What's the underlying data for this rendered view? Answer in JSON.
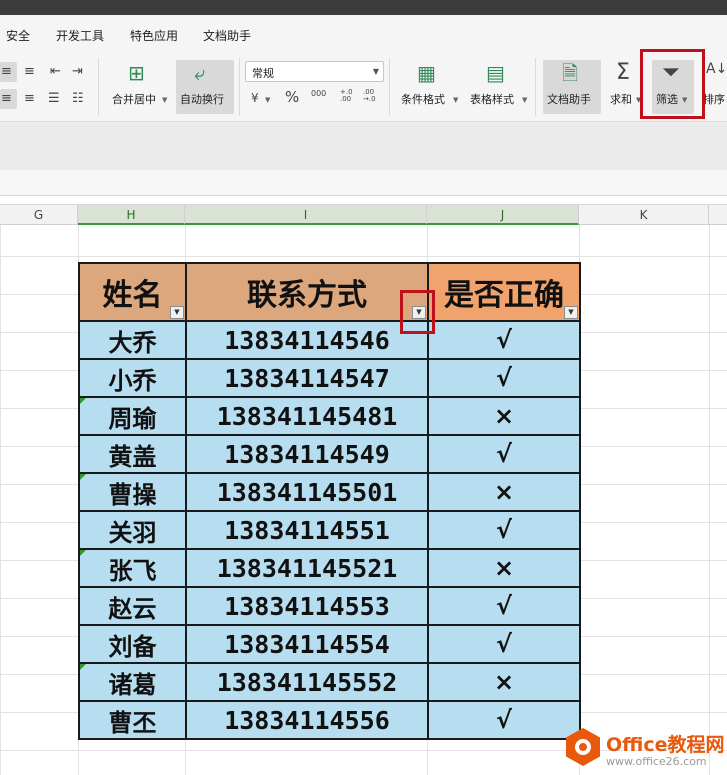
{
  "menu_tabs": [
    "安全",
    "开发工具",
    "特色应用",
    "文档助手"
  ],
  "ribbon": {
    "merge_label": "合并居中",
    "wrap_label": "自动换行",
    "number_format": "常规",
    "currency_symbol": "¥",
    "percent_symbol": "%",
    "thousands_symbol": "000",
    "inc_decimal_symbol": "+.0 .00",
    "dec_decimal_symbol": ".00 →.0",
    "conditional_format_label": "条件格式",
    "table_style_label": "表格样式",
    "doc_helper_label": "文档助手",
    "sum_label": "求和",
    "filter_label": "筛选",
    "sort_label": "排序"
  },
  "columns": [
    "G",
    "H",
    "I",
    "J",
    "K"
  ],
  "table": {
    "headers": [
      "姓名",
      "联系方式",
      "是否正确"
    ],
    "rows": [
      {
        "name": "大乔",
        "phone": "13834114546",
        "mark": "√"
      },
      {
        "name": "小乔",
        "phone": "13834114547",
        "mark": "√"
      },
      {
        "name": "周瑜",
        "phone": "138341145481",
        "mark": "×"
      },
      {
        "name": "黄盖",
        "phone": "13834114549",
        "mark": "√"
      },
      {
        "name": "曹操",
        "phone": "138341145501",
        "mark": "×"
      },
      {
        "name": "关羽",
        "phone": "13834114551",
        "mark": "√"
      },
      {
        "name": "张飞",
        "phone": "138341145521",
        "mark": "×"
      },
      {
        "name": "赵云",
        "phone": "13834114553",
        "mark": "√"
      },
      {
        "name": "刘备",
        "phone": "13834114554",
        "mark": "√"
      },
      {
        "name": "诸葛",
        "phone": "138341145552",
        "mark": "×"
      },
      {
        "name": "曹丕",
        "phone": "13834114556",
        "mark": "√"
      }
    ]
  },
  "watermark": {
    "title": "Office教程网",
    "url": "www.office26.com"
  },
  "colors": {
    "header_fill": "#dca77d",
    "header_fill_last": "#f0a36d",
    "body_fill": "#b7def0",
    "highlight": "#c0111b"
  }
}
